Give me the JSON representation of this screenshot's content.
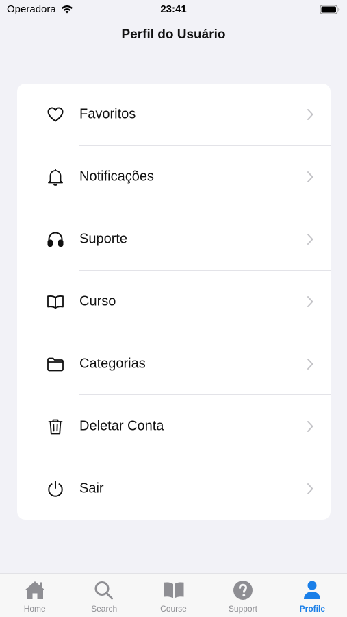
{
  "status_bar": {
    "carrier": "Operadora",
    "time": "23:41"
  },
  "nav": {
    "title": "Perfil do Usuário"
  },
  "menu": {
    "items": [
      {
        "label": "Favoritos",
        "icon": "heart-icon"
      },
      {
        "label": "Notificações",
        "icon": "bell-icon"
      },
      {
        "label": "Suporte",
        "icon": "headphones-icon"
      },
      {
        "label": "Curso",
        "icon": "book-icon"
      },
      {
        "label": "Categorias",
        "icon": "folder-icon"
      },
      {
        "label": "Deletar Conta",
        "icon": "trash-icon"
      },
      {
        "label": "Sair",
        "icon": "power-icon"
      }
    ]
  },
  "tab_bar": {
    "items": [
      {
        "label": "Home",
        "icon": "house-icon",
        "active": false
      },
      {
        "label": "Search",
        "icon": "magnifier-icon",
        "active": false
      },
      {
        "label": "Course",
        "icon": "book-icon",
        "active": false
      },
      {
        "label": "Support",
        "icon": "question-circle-icon",
        "active": false
      },
      {
        "label": "Profile",
        "icon": "person-icon",
        "active": true
      }
    ],
    "active_color": "#1a7fe8",
    "inactive_color": "#8e8e93"
  }
}
